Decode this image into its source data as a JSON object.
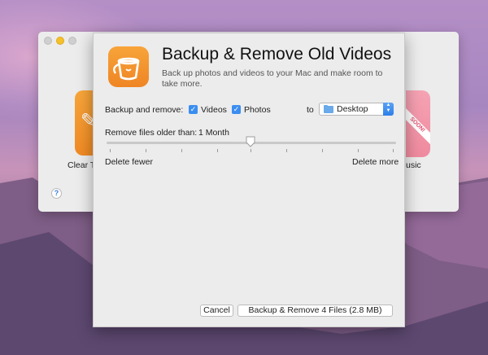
{
  "background_app": {
    "left_app_label": "Clear T",
    "right_app_label": "usic",
    "right_badge": "SOON!",
    "help_label": "?"
  },
  "dialog": {
    "title": "Backup & Remove Old Videos",
    "subtitle": "Back up photos and videos to your Mac and make room to take more.",
    "backup_remove_label": "Backup and remove:",
    "videos_label": "Videos",
    "videos_checked": true,
    "photos_label": "Photos",
    "photos_checked": true,
    "to_label": "to",
    "destination": "Desktop",
    "remove_older_label": "Remove files older than:",
    "age_value": "1 Month",
    "slider_position_fraction": 0.5,
    "slider_ticks": 9,
    "delete_fewer_label": "Delete fewer",
    "delete_more_label": "Delete more",
    "cancel_label": "Cancel",
    "confirm_label": "Backup & Remove 4 Files (2.8 MB)"
  },
  "colors": {
    "accent": "#3b8ef0",
    "app_icon": "#f29530"
  }
}
